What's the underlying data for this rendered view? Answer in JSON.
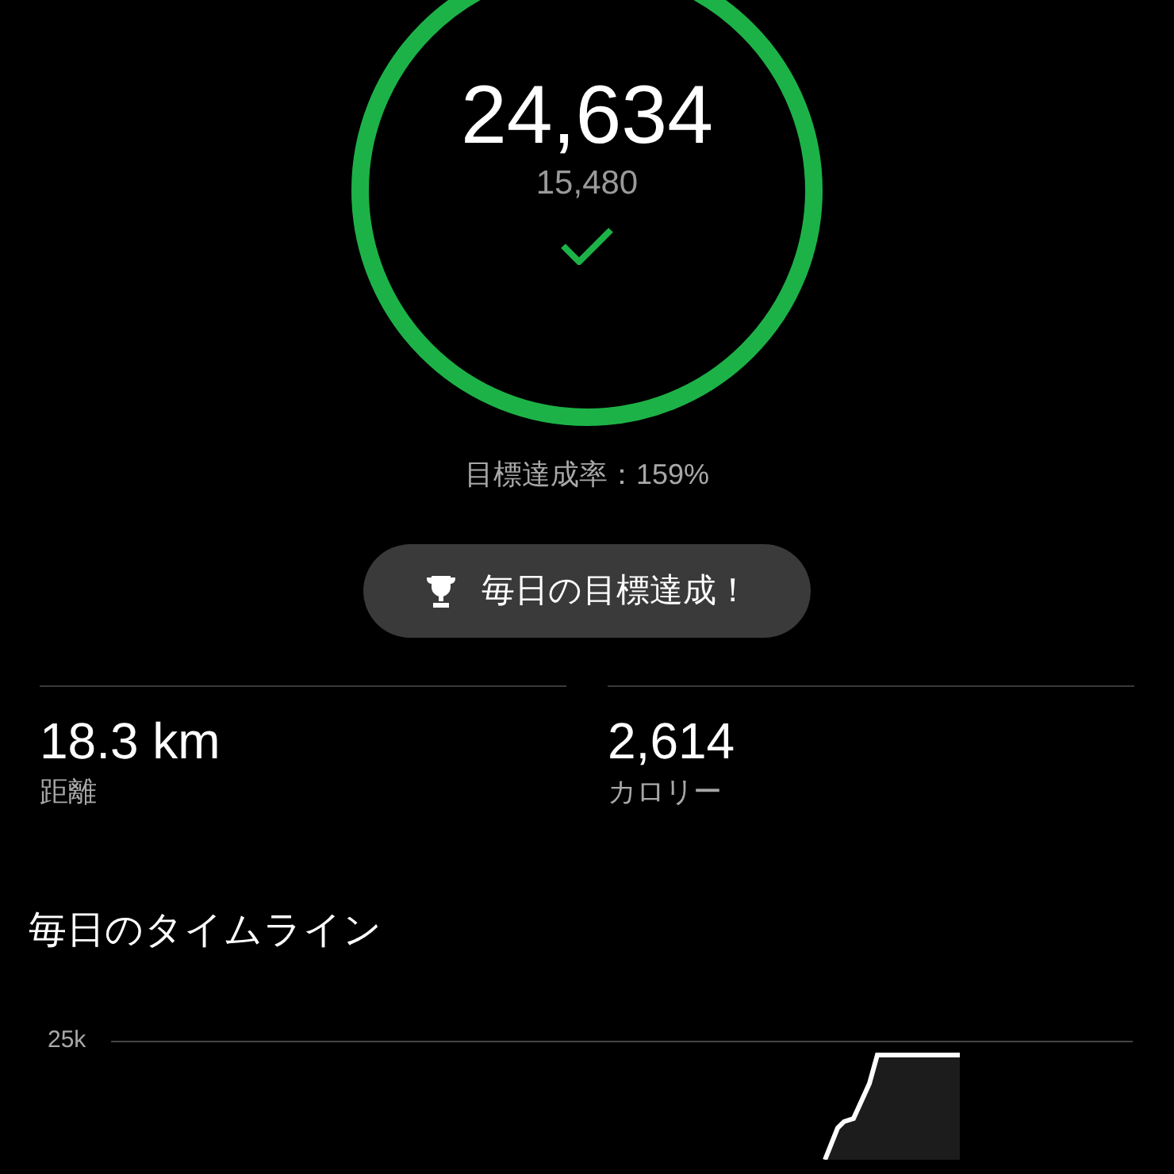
{
  "goal_ring": {
    "steps": "24,634",
    "goal": "15,480",
    "achieved": true
  },
  "goal_rate": "目標達成率：159%",
  "achievement_badge": {
    "label": "毎日の目標達成！"
  },
  "stats": [
    {
      "value": "18.3 km",
      "label": "距離"
    },
    {
      "value": "2,614",
      "label": "カロリー"
    }
  ],
  "timeline": {
    "title": "毎日のタイムライン",
    "y_label": "25k"
  }
}
